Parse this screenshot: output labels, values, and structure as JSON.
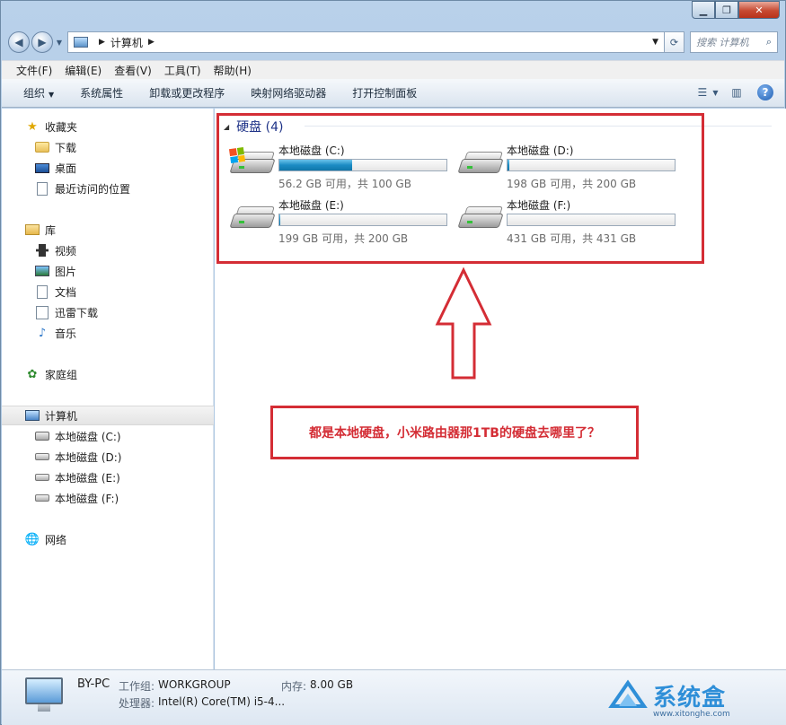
{
  "address": {
    "crumb": "计算机",
    "search_placeholder": "搜索 计算机"
  },
  "menu": [
    "文件(F)",
    "编辑(E)",
    "查看(V)",
    "工具(T)",
    "帮助(H)"
  ],
  "commands": {
    "organize": "组织",
    "system_props": "系统属性",
    "uninstall": "卸载或更改程序",
    "map_drive": "映射网络驱动器",
    "control_panel": "打开控制面板"
  },
  "sidebar": {
    "favorites": "收藏夹",
    "downloads": "下载",
    "desktop": "桌面",
    "recent": "最近访问的位置",
    "libraries": "库",
    "videos": "视频",
    "pictures": "图片",
    "documents": "文档",
    "xunlei": "迅雷下载",
    "music": "音乐",
    "homegroup": "家庭组",
    "computer": "计算机",
    "drive_c": "本地磁盘 (C:)",
    "drive_d": "本地磁盘 (D:)",
    "drive_e": "本地磁盘 (E:)",
    "drive_f": "本地磁盘 (F:)",
    "network": "网络"
  },
  "group": {
    "title": "硬盘 (4)"
  },
  "drives": [
    {
      "name": "本地磁盘 (C:)",
      "free": "56.2 GB 可用，共 100 GB",
      "used_fraction": 0.438
    },
    {
      "name": "本地磁盘 (D:)",
      "free": "198 GB 可用，共 200 GB",
      "used_fraction": 0.01
    },
    {
      "name": "本地磁盘 (E:)",
      "free": "199 GB 可用，共 200 GB",
      "used_fraction": 0.005
    },
    {
      "name": "本地磁盘 (F:)",
      "free": "431 GB 可用，共 431 GB",
      "used_fraction": 0.0
    }
  ],
  "annotation": "都是本地硬盘，小米路由器那1TB的硬盘去哪里了？",
  "details": {
    "pc_name": "BY-PC",
    "workgroup_label": "工作组:",
    "workgroup": "WORKGROUP",
    "memory_label": "内存:",
    "memory": "8.00 GB",
    "cpu_label": "处理器:",
    "cpu": "Intel(R) Core(TM) i5-4..."
  },
  "watermark": {
    "text": "系统盒",
    "url": "www.xitonghe.com"
  },
  "colors": {
    "annotation_red": "#d42d35",
    "group_title": "#1e3287",
    "bar_fill": "#1b8cc4"
  }
}
